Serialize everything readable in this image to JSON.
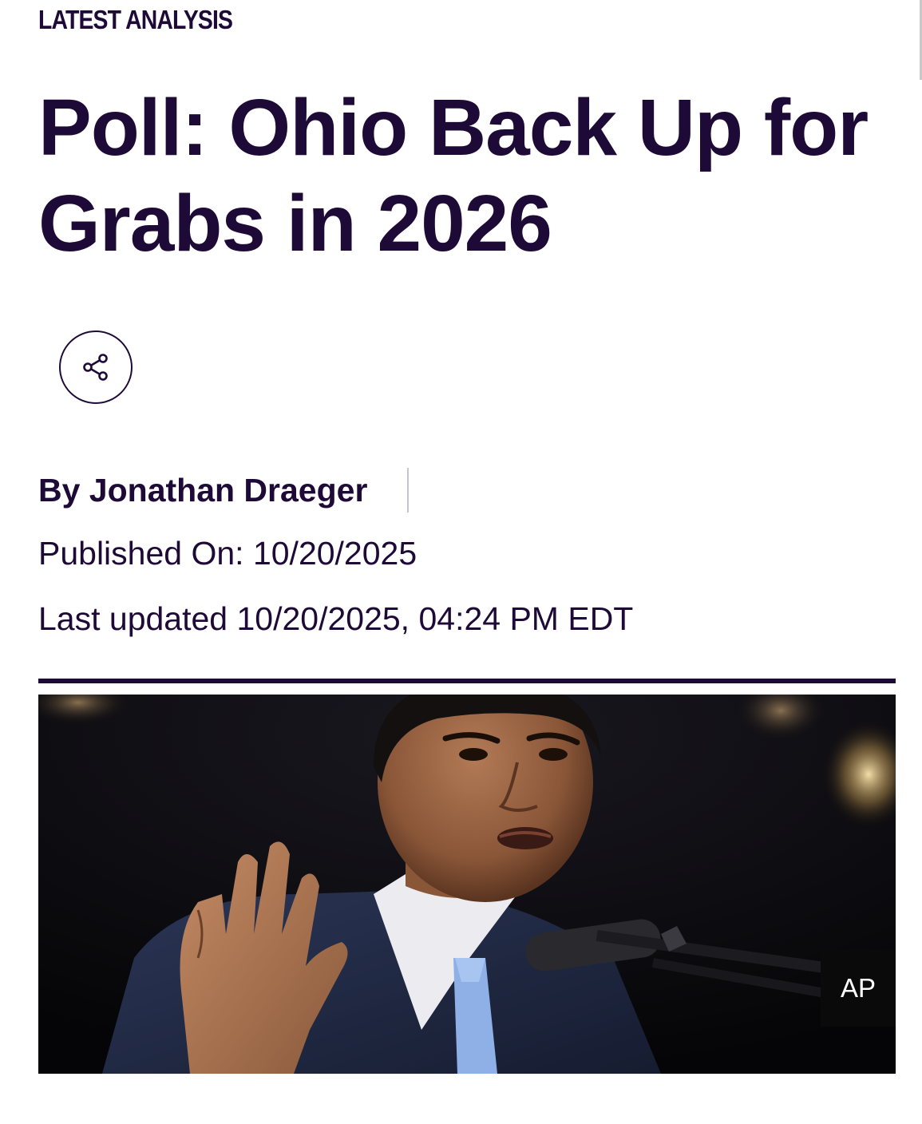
{
  "article": {
    "kicker": "LATEST ANALYSIS",
    "headline": "Poll: Ohio Back Up for Grabs in 2026",
    "byline": "By Jonathan Draeger",
    "published": "Published On: 10/20/2025",
    "updated": "Last updated 10/20/2025, 04:24 PM EDT",
    "share_icon": "share-icon",
    "image": {
      "credit": "AP"
    }
  },
  "colors": {
    "text": "#1e0a36",
    "rule": "#1e0a36",
    "divider": "#c8c4cc",
    "credit_bg": "#0a0a0a"
  }
}
